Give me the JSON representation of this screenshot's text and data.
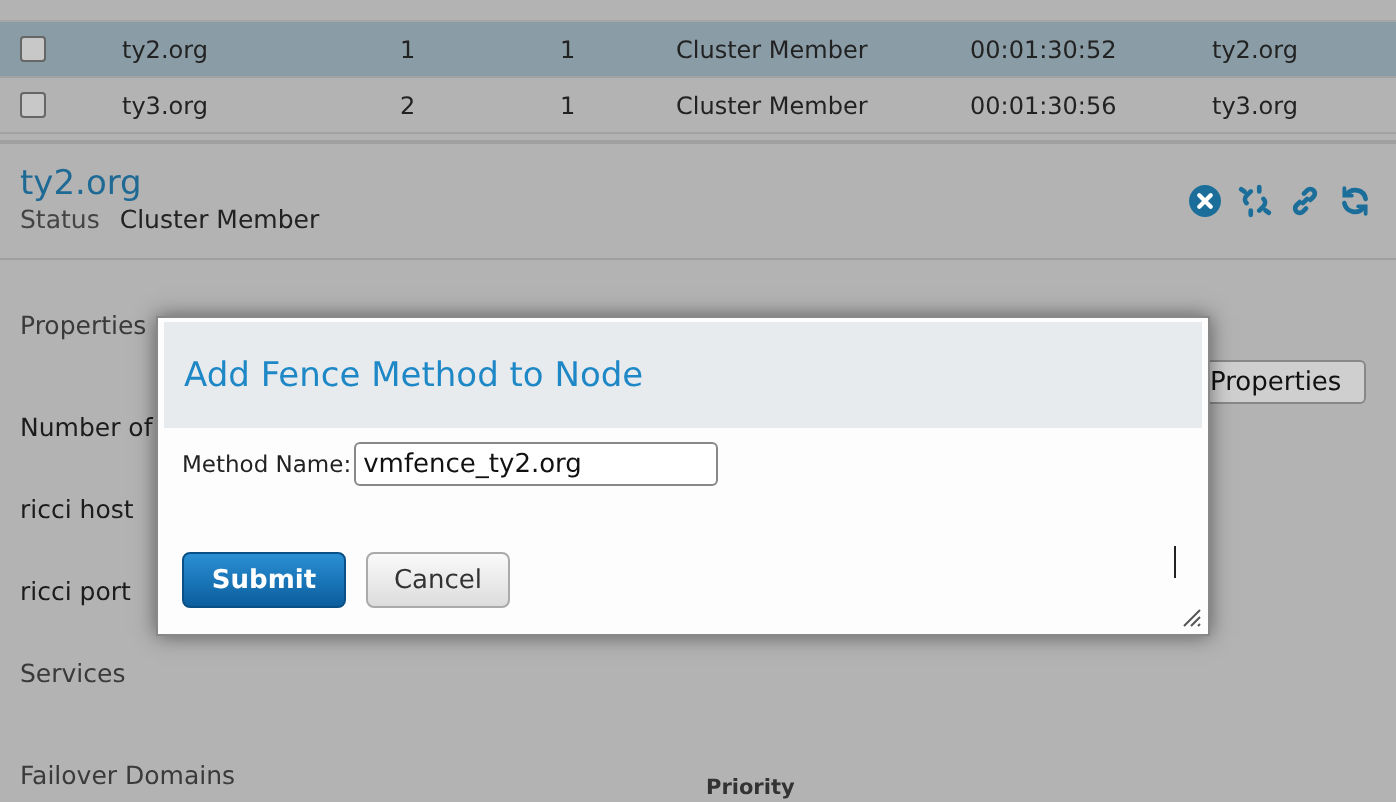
{
  "table": {
    "rows": [
      {
        "checked": false,
        "selected": true,
        "cells": [
          "ty2.org",
          "1",
          "1",
          "Cluster Member",
          "00:01:30:52",
          "ty2.org"
        ]
      },
      {
        "checked": false,
        "selected": false,
        "cells": [
          "ty3.org",
          "2",
          "1",
          "Cluster Member",
          "00:01:30:56",
          "ty3.org"
        ]
      }
    ]
  },
  "node": {
    "title": "ty2.org",
    "status_label": "Status",
    "status_value": "Cluster Member"
  },
  "sections": [
    {
      "kind": "heading",
      "label": "Properties"
    },
    {
      "kind": "field",
      "label": "Number of"
    },
    {
      "kind": "field",
      "label": "ricci host"
    },
    {
      "kind": "field",
      "label": "ricci port"
    },
    {
      "kind": "heading",
      "label": "Services"
    },
    {
      "kind": "heading",
      "label": "Failover Domains"
    }
  ],
  "properties_button": "Properties",
  "priority_header": "Priority",
  "dialog": {
    "title": "Add Fence Method to Node",
    "field_label": "Method Name:",
    "field_value": "vmfence_ty2.org",
    "buttons": [
      {
        "label": "Submit",
        "kind": "primary"
      },
      {
        "label": "Cancel",
        "kind": "secondary"
      }
    ]
  }
}
